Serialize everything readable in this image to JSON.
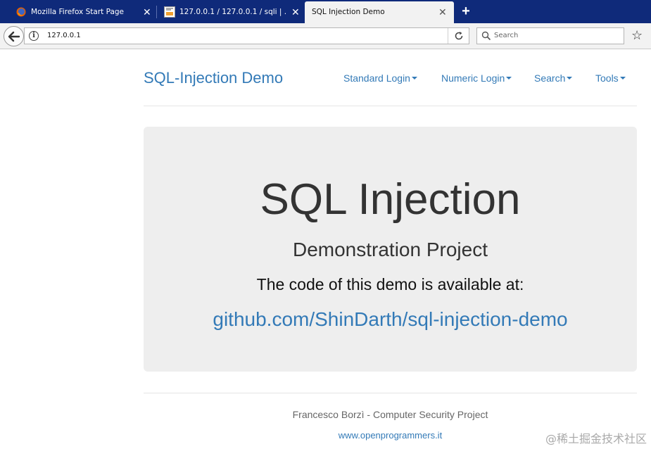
{
  "browser": {
    "tabs": [
      {
        "title": "Mozilla Firefox Start Page",
        "active": false
      },
      {
        "title": "127.0.0.1 / 127.0.0.1 / sqli | ...",
        "active": false
      },
      {
        "title": "SQL Injection Demo",
        "active": true
      }
    ],
    "close_glyph": "✕",
    "new_tab_glyph": "+",
    "url": "127.0.0.1",
    "search_placeholder": "Search",
    "bookmark_glyph": "☆"
  },
  "site": {
    "brand": "SQL-Injection Demo",
    "nav": [
      {
        "label": "Standard Login"
      },
      {
        "label": "Numeric Login"
      },
      {
        "label": "Search"
      },
      {
        "label": "Tools"
      }
    ]
  },
  "jumbotron": {
    "title": "SQL Injection",
    "subtitle": "Demonstration Project",
    "text": "The code of this demo is available at:",
    "link": "github.com/ShinDarth/sql-injection-demo"
  },
  "footer": {
    "credit": "Francesco Borzì - Computer Security Project",
    "link": "www.openprogrammers.it"
  },
  "watermark": "@稀土掘金技术社区",
  "colors": {
    "tabbar": "#0f2a7a",
    "link": "#337ab7",
    "jumbotron_bg": "#eeeeee"
  }
}
